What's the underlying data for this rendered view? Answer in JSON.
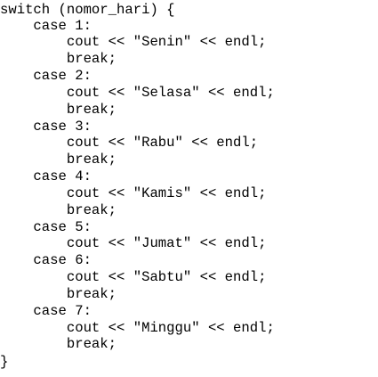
{
  "code_lines": [
    "switch (nomor_hari) {",
    "    case 1:",
    "        cout << \"Senin\" << endl;",
    "        break;",
    "    case 2:",
    "        cout << \"Selasa\" << endl;",
    "        break;",
    "    case 3:",
    "        cout << \"Rabu\" << endl;",
    "        break;",
    "    case 4:",
    "        cout << \"Kamis\" << endl;",
    "        break;",
    "    case 5:",
    "        cout << \"Jumat\" << endl;",
    "    case 6:",
    "        cout << \"Sabtu\" << endl;",
    "        break;",
    "    case 7:",
    "        cout << \"Minggu\" << endl;",
    "        break;",
    "}"
  ]
}
